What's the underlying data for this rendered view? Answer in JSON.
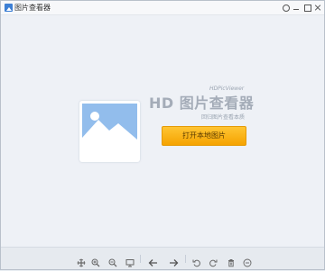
{
  "window": {
    "title": "图片查看器",
    "title_icon": "picture-icon",
    "controls": [
      "settings-icon",
      "minimize-icon",
      "maximize-icon",
      "close-icon"
    ]
  },
  "welcome": {
    "brand_sub": "HDPicViewer",
    "brand_title": "HD 图片查看器",
    "slogan": "回归图片查看本质",
    "open_button_label": "打开本地图片",
    "open_button_color": "#f9b313",
    "placeholder_icon": "image-placeholder-icon"
  },
  "toolbar": {
    "buttons": [
      "fit-icon",
      "zoom-in-icon",
      "zoom-out-icon",
      "actual-size-icon",
      "previous-icon",
      "next-icon",
      "rotate-left-icon",
      "rotate-right-icon",
      "delete-icon",
      "more-icon"
    ]
  }
}
